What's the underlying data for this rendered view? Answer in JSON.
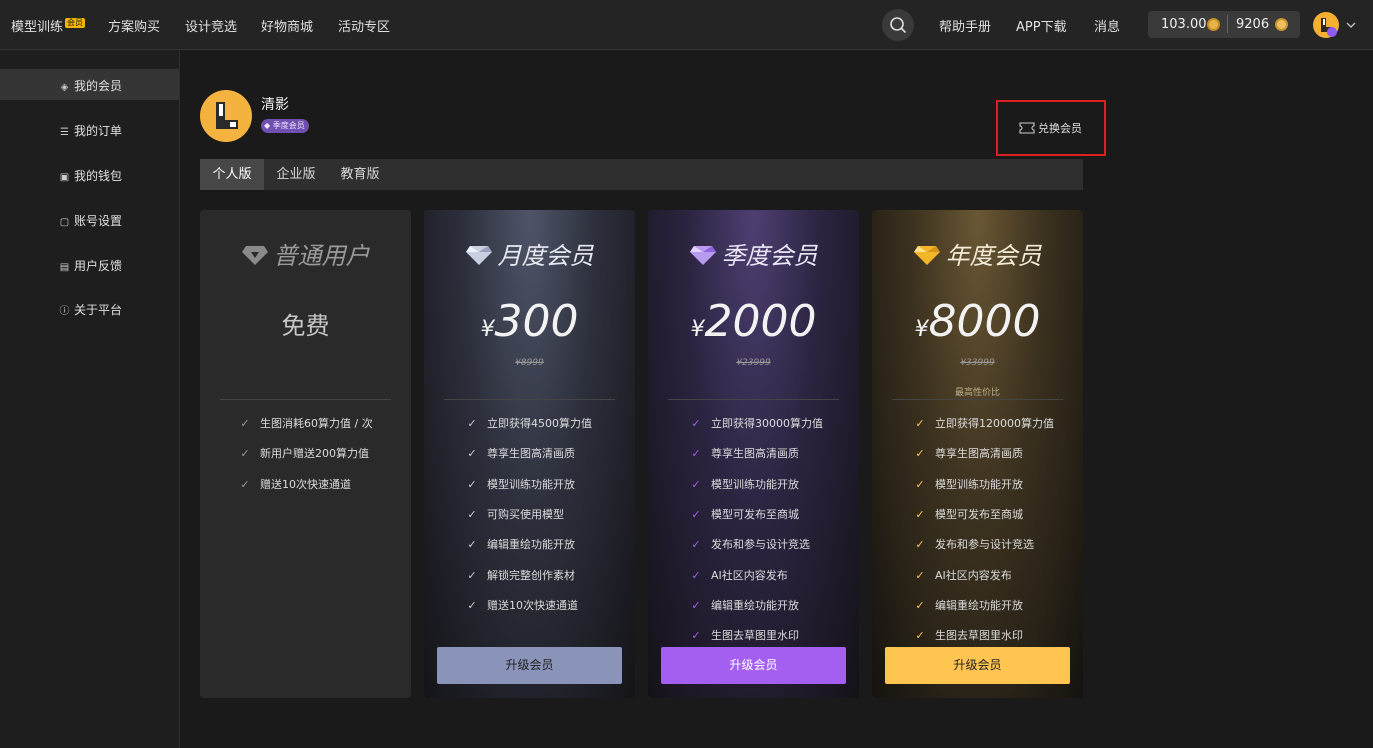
{
  "nav": {
    "items": [
      {
        "label": "模型训练",
        "badge": "会员"
      },
      {
        "label": "方案购买"
      },
      {
        "label": "设计竞选"
      },
      {
        "label": "好物商城"
      },
      {
        "label": "活动专区"
      }
    ],
    "help": "帮助手册",
    "app_download": "APP下载",
    "messages": "消息",
    "balance_1": "103.00",
    "balance_2": "9206"
  },
  "sidebar": {
    "items": [
      {
        "label": "我的会员",
        "icon": "shield-icon",
        "active": true
      },
      {
        "label": "我的订单",
        "icon": "list-icon"
      },
      {
        "label": "我的钱包",
        "icon": "wallet-icon"
      },
      {
        "label": "账号设置",
        "icon": "user-card-icon"
      },
      {
        "label": "用户反馈",
        "icon": "feedback-icon"
      },
      {
        "label": "关于平台",
        "icon": "info-icon"
      }
    ]
  },
  "profile": {
    "name": "清影",
    "member_badge": "季度会员",
    "redeem": "兑换会员"
  },
  "tabs": [
    "个人版",
    "企业版",
    "教育版"
  ],
  "plans": {
    "free": {
      "title": "普通用户",
      "price_text": "免费",
      "features": [
        "生图消耗60算力值 / 次",
        "新用户赠送200算力值",
        "赠送10次快速通道"
      ]
    },
    "month": {
      "title": "月度会员",
      "currency": "¥",
      "price": "300",
      "original": "¥8999",
      "features": [
        "立即获得4500算力值",
        "尊享生图高清画质",
        "模型训练功能开放",
        "可购买使用模型",
        "编辑重绘功能开放",
        "解锁完整创作素材",
        "赠送10次快速通道"
      ],
      "button": "升级会员"
    },
    "season": {
      "title": "季度会员",
      "currency": "¥",
      "price": "2000",
      "original": "¥23999",
      "features": [
        "立即获得30000算力值",
        "尊享生图高清画质",
        "模型训练功能开放",
        "模型可发布至商城",
        "发布和参与设计竞选",
        "AI社区内容发布",
        "编辑重绘功能开放",
        "生图去草图里水印"
      ],
      "button": "升级会员"
    },
    "year": {
      "title": "年度会员",
      "currency": "¥",
      "price": "8000",
      "original": "¥33999",
      "note": "最高性价比",
      "features": [
        "立即获得120000算力值",
        "尊享生图高清画质",
        "模型训练功能开放",
        "模型可发布至商城",
        "发布和参与设计竞选",
        "AI社区内容发布",
        "编辑重绘功能开放",
        "生图去草图里水印"
      ],
      "button": "升级会员"
    }
  },
  "colors": {
    "month_accent": "#8a93b8",
    "season_accent": "#a45ff0",
    "year_accent": "#ffc550"
  }
}
